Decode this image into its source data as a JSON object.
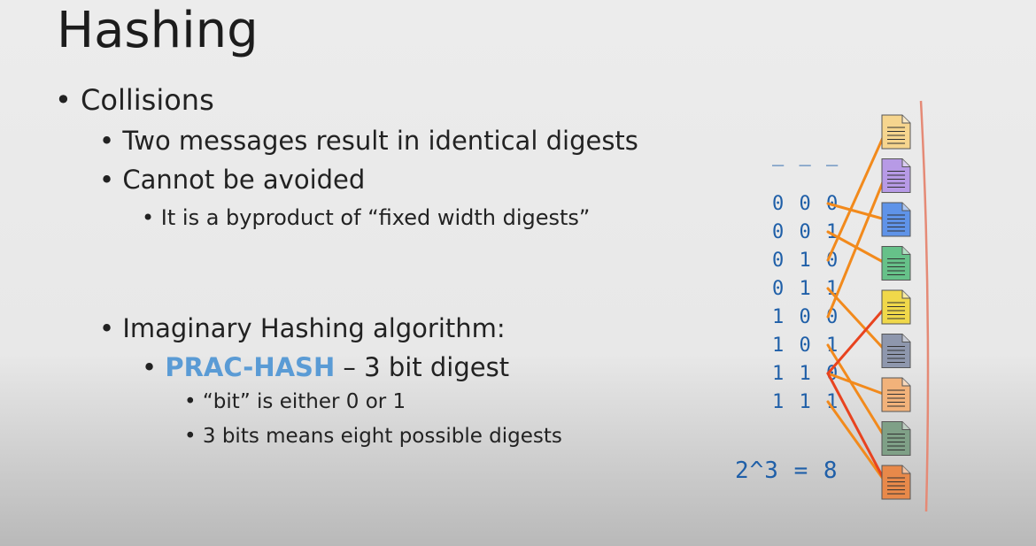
{
  "slide": {
    "title": "Hashing",
    "bullets": {
      "collisions": "Collisions",
      "two_messages": "Two messages result in identical digests",
      "cannot_avoid": "Cannot be avoided",
      "byproduct": "It is a byproduct of “fixed width digests”",
      "imaginary": "Imaginary Hashing algorithm:",
      "prac_hash_name": "PRAC-HASH",
      "prac_hash_rest": " – 3 bit digest",
      "bit_def": "“bit” is either 0 or 1",
      "three_bits": "3 bits means eight possible digests"
    }
  },
  "diagram": {
    "placeholder": "_ _ _",
    "digests": [
      "0 0 0",
      "0 0 1",
      "0 1 0",
      "0 1 1",
      "1 0 0",
      "1 0 1",
      "1 1 0",
      "1 1 1"
    ],
    "formula": "2^3 = 8",
    "document_colors": [
      "#f6d58e",
      "#b79ae6",
      "#5f93e8",
      "#66c189",
      "#f0d84a",
      "#8e97ad",
      "#f2b27a",
      "#7fa087",
      "#e8894a"
    ],
    "line_color": "#f28a1c",
    "collision_line_color": "#e8431f",
    "mappings": [
      {
        "code": 0,
        "doc": 2
      },
      {
        "code": 1,
        "doc": 3
      },
      {
        "code": 2,
        "doc": 0
      },
      {
        "code": 3,
        "doc": 5
      },
      {
        "code": 4,
        "doc": 1
      },
      {
        "code": 5,
        "doc": 7
      },
      {
        "code": 6,
        "doc": 6
      },
      {
        "code": 7,
        "doc": 8
      }
    ],
    "collision": {
      "code": 6,
      "docs": [
        4,
        8
      ]
    }
  }
}
